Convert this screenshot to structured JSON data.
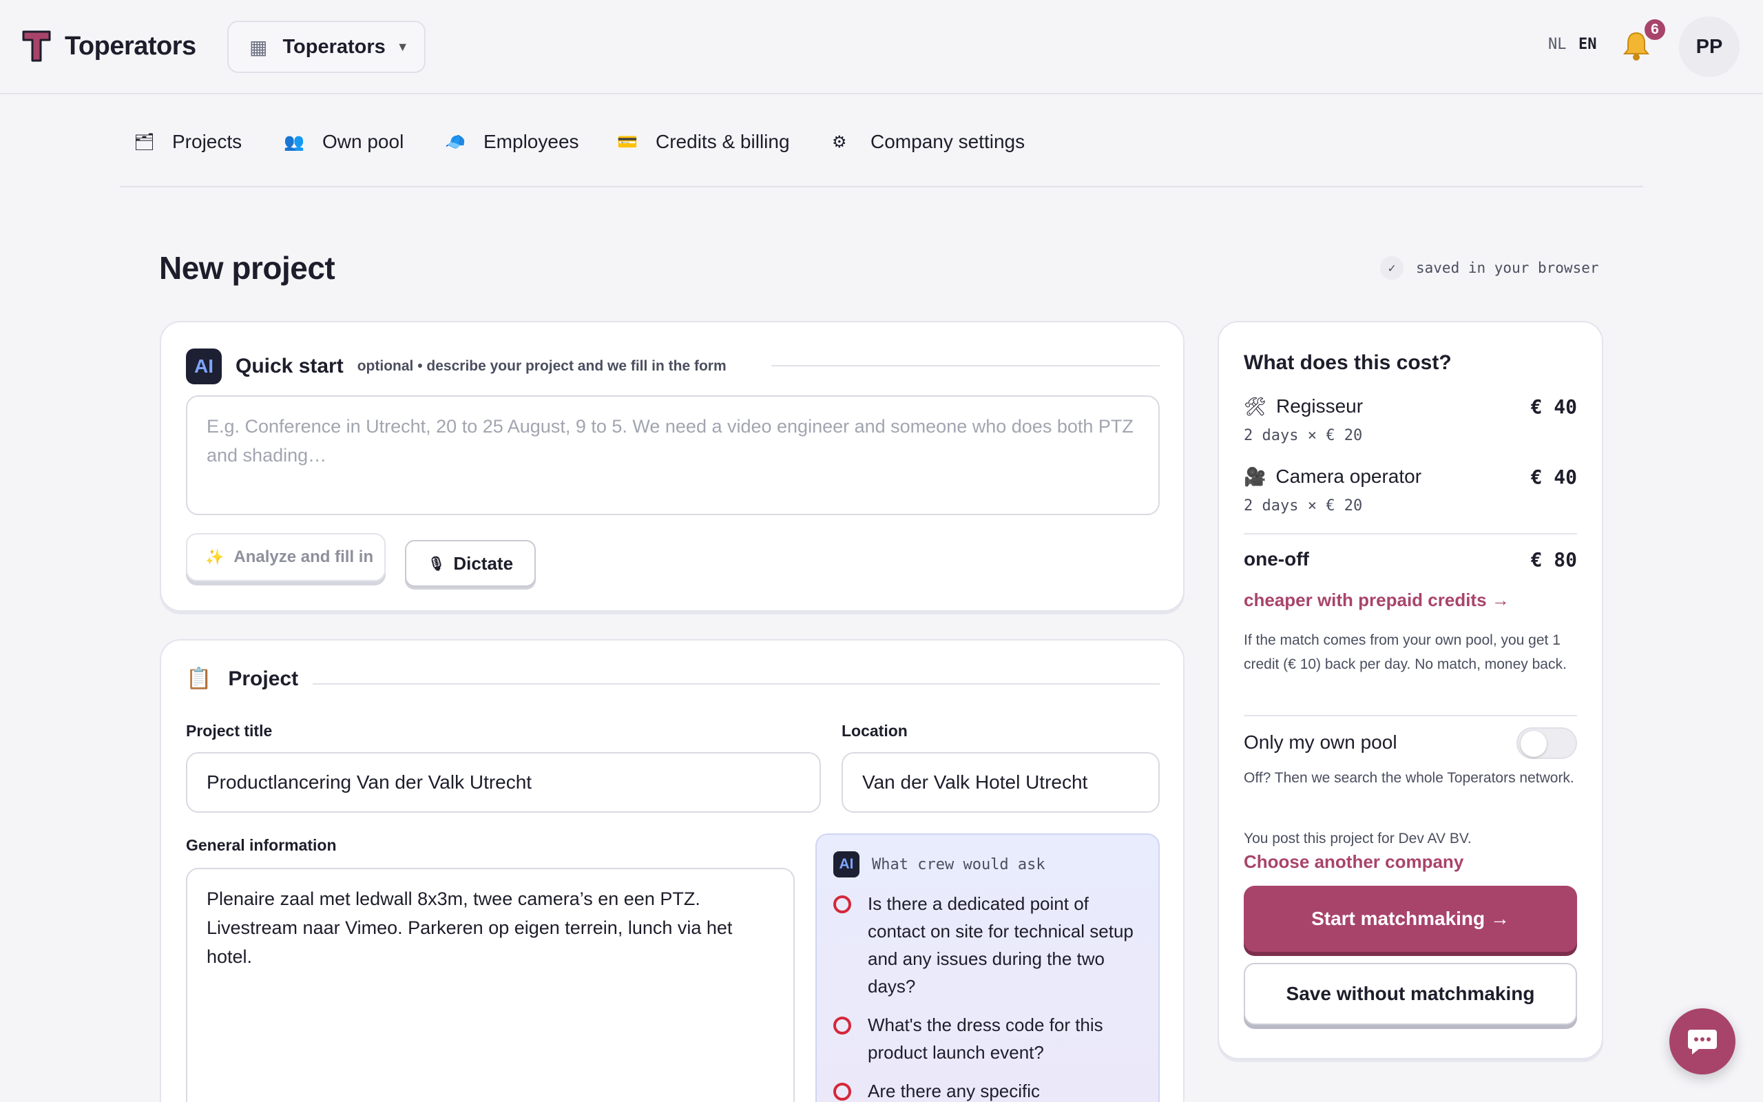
{
  "app": {
    "name": "Toperators",
    "company": "Toperators",
    "lang_nl": "NL",
    "lang_en": "EN",
    "notifications": "6",
    "avatar_initials": "PP",
    "accent_color": "#a8446a"
  },
  "nav": {
    "projects": "Projects",
    "own_pool": "Own pool",
    "employees": "Employees",
    "billing": "Credits & billing",
    "settings": "Company settings"
  },
  "page": {
    "title": "New project",
    "saved": "saved in your browser"
  },
  "quick_start": {
    "badge": "AI",
    "title": "Quick start",
    "subtitle": "optional • describe your project and we fill in the form",
    "placeholder": "E.g. Conference in Utrecht, 20 to 25 August, 9 to 5. We need a video engineer and someone who does both PTZ and shading…",
    "analyze": "Analyze and fill in",
    "dictate": "Dictate"
  },
  "project": {
    "title": "Project",
    "title_label": "Project title",
    "title_value": "Productlancering Van der Valk Utrecht",
    "location_label": "Location",
    "location_value": "Van der Valk Hotel Utrecht",
    "info_label": "General information",
    "info_value": "Plenaire zaal met ledwall 8x3m, twee camera’s en een PTZ. Livestream naar Vimeo. Parkeren op eigen terrein, lunch via het hotel.",
    "ask_badge": "AI",
    "ask_title": "What crew would ask",
    "ask_items": [
      "Is there a dedicated point of contact on site for technical setup and any issues during the two days?",
      "What's the dress code for this product launch event?",
      "Are there any specific"
    ]
  },
  "cost": {
    "title": "What does this cost?",
    "roles": [
      {
        "name": "Regisseur",
        "price": "€ 40",
        "calc": "2 days × € 20"
      },
      {
        "name": "Camera operator",
        "price": "€ 40",
        "calc": "2 days × € 20"
      }
    ],
    "total_label": "one-off",
    "total_price": "€ 80",
    "prepaid_link": "cheaper with prepaid credits →",
    "refund_note": "If the match comes from your own pool, you get 1 credit (€ 10) back per day. No match, money back.",
    "own_pool_label": "Only my own pool",
    "own_pool_on": false,
    "own_pool_note": "Off? Then we search the whole Toperators network.",
    "post_for": "You post this project for Dev AV BV.",
    "choose_company": "Choose another company",
    "start": "Start matchmaking →",
    "save": "Save without matchmaking"
  }
}
